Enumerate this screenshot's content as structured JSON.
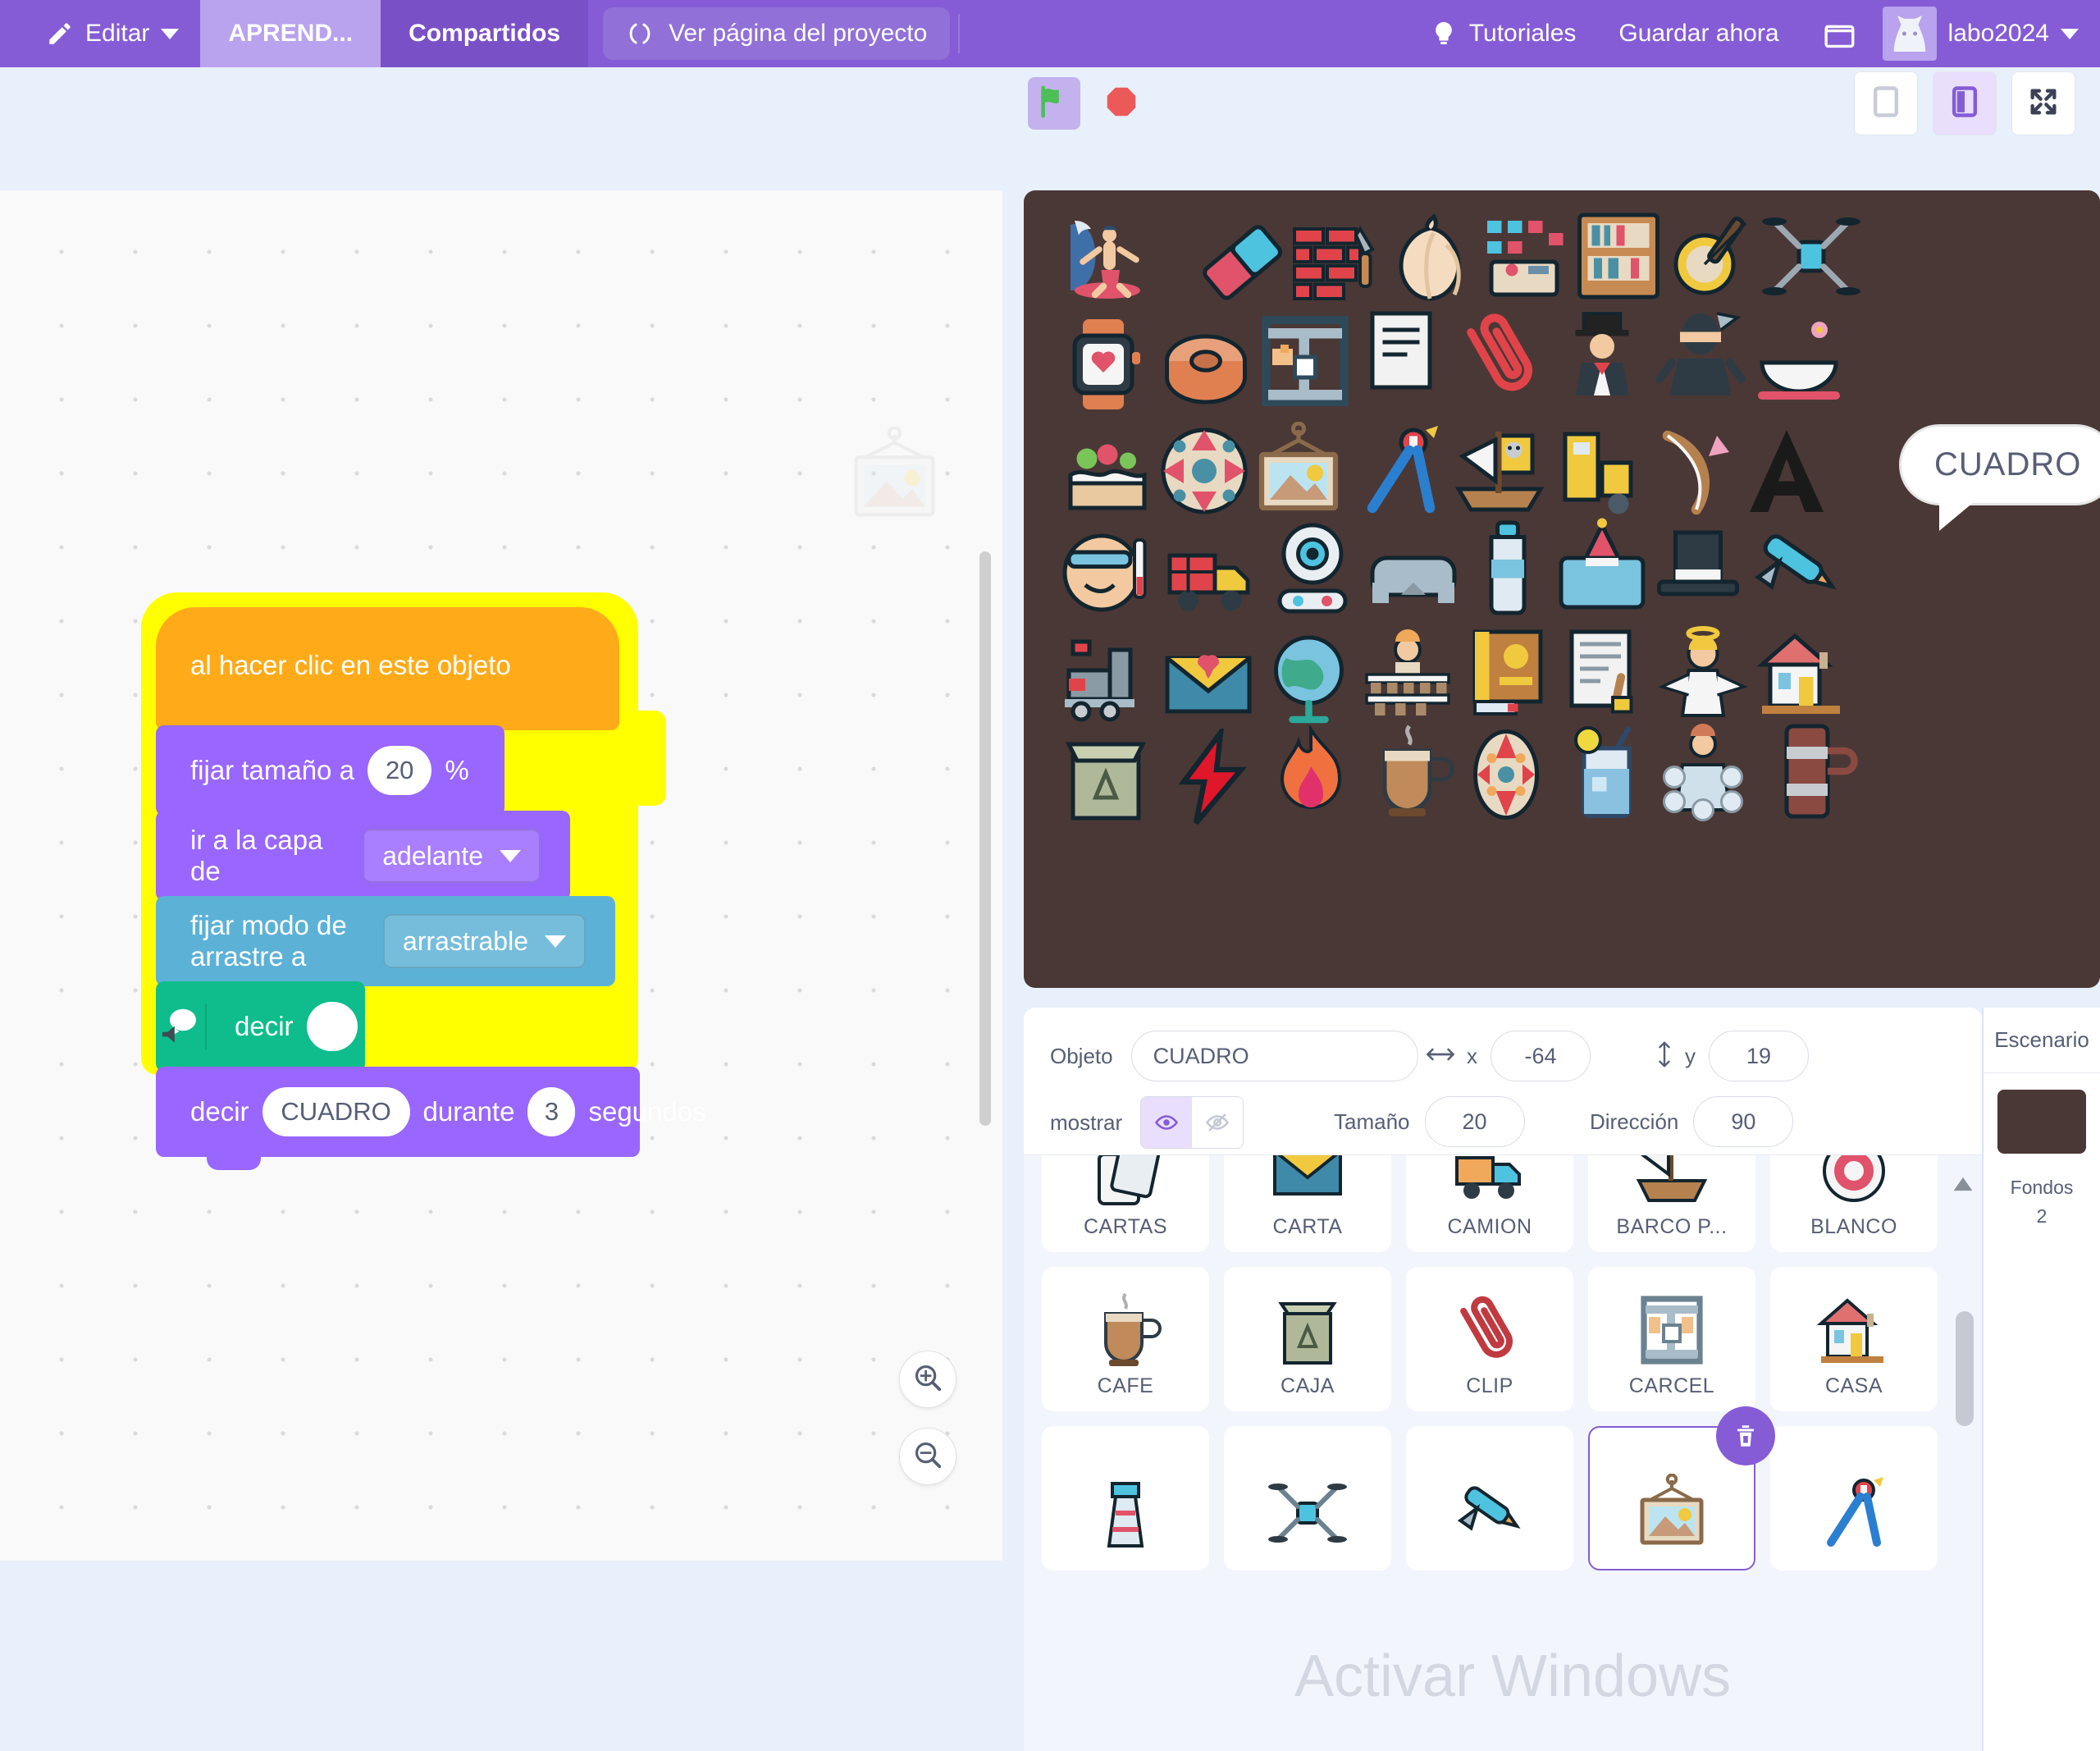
{
  "menubar": {
    "edit_label": "Editar",
    "tab_active": "APREND...",
    "tab_shared": "Compartidos",
    "see_project": "Ver página del proyecto",
    "tutorials": "Tutoriales",
    "save_now": "Guardar ahora",
    "username": "labo2024",
    "bg_color": "#855cd6",
    "active_tab_color": "#b9a2ee"
  },
  "controlbar": {
    "green_flag": "green-flag",
    "stop": "stop-sign",
    "layout_small": "small-stage-layout",
    "layout_normal": "normal-stage-layout",
    "layout_full": "fullscreen-layout"
  },
  "code": {
    "blocks": [
      {
        "id": "hat",
        "text1": "al hacer clic en este objeto",
        "color": "#ffab19"
      },
      {
        "id": "size",
        "text1": "fijar tamaño a",
        "value": "20",
        "text2": "%",
        "color": "#9966ff"
      },
      {
        "id": "layer",
        "text1": "ir a la capa  de",
        "dropdown": "adelante",
        "color": "#9966ff"
      },
      {
        "id": "drag",
        "text1": "fijar modo de arrastre a",
        "dropdown": "arrastrable",
        "color": "#5cb1d6"
      },
      {
        "id": "say",
        "text1": "decir",
        "value": "",
        "color": "#0fbd8c"
      },
      {
        "id": "sayfor",
        "text1": "decir",
        "value": "CUADRO",
        "text2": "durante",
        "value2": "3",
        "text3": "segundos",
        "color": "#9966ff"
      }
    ],
    "zoom_in": "zoom-in",
    "zoom_out": "zoom-out",
    "glow_color": "#ffff00"
  },
  "stage": {
    "bubble_text": "CUADRO",
    "background_color": "#4a3836"
  },
  "sprite_info": {
    "objeto_label": "Objeto",
    "objeto_value": "CUADRO",
    "x_label": "x",
    "x_value": "-64",
    "y_label": "y",
    "y_value": "19",
    "mostrar_label": "mostrar",
    "mostrar_on": true,
    "tamano_label": "Tamaño",
    "tamano_value": "20",
    "direccion_label": "Dirección",
    "direccion_value": "90"
  },
  "sprite_list": {
    "rows": [
      [
        {
          "name": "CARTAS",
          "icon": "cards-icon",
          "selected": false
        },
        {
          "name": "CARTA",
          "icon": "letter-icon",
          "selected": false
        },
        {
          "name": "CAMION",
          "icon": "truck-icon",
          "selected": false
        },
        {
          "name": "BARCO P...",
          "icon": "pirate-ship-icon",
          "selected": false
        },
        {
          "name": "BLANCO",
          "icon": "target-icon",
          "selected": false
        }
      ],
      [
        {
          "name": "CAFE",
          "icon": "coffee-icon",
          "selected": false
        },
        {
          "name": "CAJA",
          "icon": "box-icon",
          "selected": false
        },
        {
          "name": "CLIP",
          "icon": "clip-icon",
          "selected": false
        },
        {
          "name": "CARCEL",
          "icon": "jail-icon",
          "selected": false
        },
        {
          "name": "CASA",
          "icon": "house-icon",
          "selected": false
        }
      ],
      [
        {
          "name": "",
          "icon": "lighthouse-icon",
          "selected": false
        },
        {
          "name": "",
          "icon": "drone-icon",
          "selected": false
        },
        {
          "name": "",
          "icon": "gluegun-icon",
          "selected": false
        },
        {
          "name": "",
          "icon": "frame-icon",
          "selected": true
        },
        {
          "name": "",
          "icon": "compass-icon",
          "selected": false
        }
      ]
    ],
    "delete_badge": "trash-icon"
  },
  "stage_panel": {
    "title": "Escenario",
    "fondos_label": "Fondos",
    "fondos_count": "2"
  },
  "watermark": {
    "text": "Activar Windows"
  }
}
